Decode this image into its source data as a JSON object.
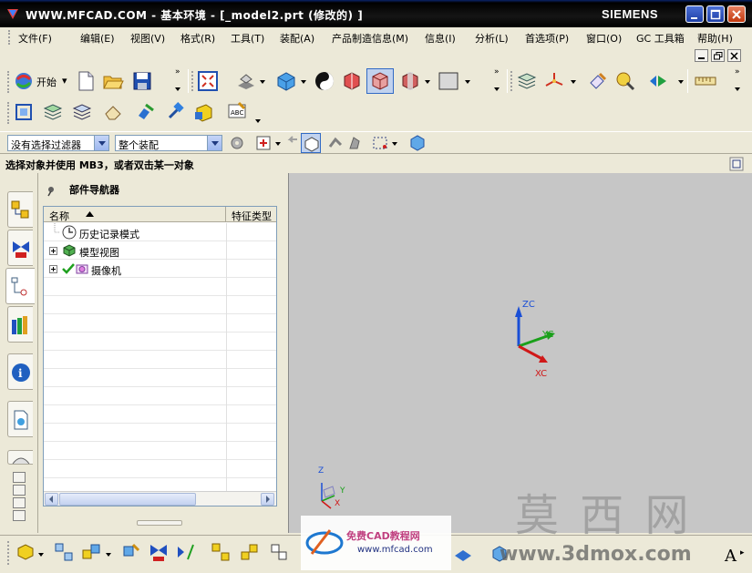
{
  "window": {
    "title": "WWW.MFCAD.COM - 基本环境 - [_model2.prt  (修改的) ]",
    "brand": "SIEMENS"
  },
  "menu": [
    {
      "label": "文件(F)"
    },
    {
      "label": "编辑(E)"
    },
    {
      "label": "视图(V)"
    },
    {
      "label": "格式(R)"
    },
    {
      "label": "工具(T)"
    },
    {
      "label": "装配(A)"
    },
    {
      "label": "产品制造信息(M)"
    },
    {
      "label": "信息(I)"
    },
    {
      "label": "分析(L)"
    },
    {
      "label": "首选项(P)"
    },
    {
      "label": "窗口(O)"
    },
    {
      "label": "GC 工具箱"
    },
    {
      "label": "帮助(H)"
    }
  ],
  "toolbar": {
    "start_label": "开始",
    "start_arrow": "▾"
  },
  "selection_bar": {
    "filter_value": "没有选择过滤器",
    "scope_value": "整个装配"
  },
  "cue_line": "选择对象并使用 MB3，或者双击某一对象",
  "navigator": {
    "title": "部件导航器",
    "columns": [
      {
        "label": "名称"
      },
      {
        "label": "特征类型"
      }
    ],
    "items": [
      {
        "label": "历史记录模式",
        "icon": "clock-icon"
      },
      {
        "label": "模型视图",
        "icon": "model-views-icon"
      },
      {
        "label": "摄像机",
        "icon": "camera-icon"
      }
    ]
  },
  "triad": {
    "zc": "ZC",
    "yc": "YC",
    "xc": "XC"
  },
  "small_triad": {
    "z": "Z",
    "y": "Y",
    "x": "X"
  },
  "watermarks": {
    "mox": "莫 西 网",
    "site1": "www.mfcad.com",
    "site2": "www.3dmox.com",
    "logo_text": "免费CAD教程网"
  },
  "colors": {
    "zc": "#1a4fd6",
    "yc": "#1aa01a",
    "xc": "#d01818",
    "graphics_bg": "#c6c6c6"
  }
}
